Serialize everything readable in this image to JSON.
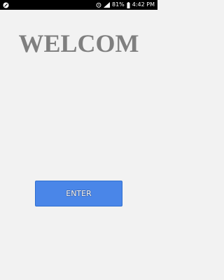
{
  "status_bar": {
    "battery_percent": "81%",
    "time": "4:42 PM",
    "icons": [
      "app-notification-icon",
      "alarm-icon",
      "signal-icon",
      "battery-icon"
    ]
  },
  "screen": {
    "title": "WELCOM",
    "enter_button_label": "ENTER"
  },
  "colors": {
    "background": "#f2f2f2",
    "title": "#7f7f7f",
    "button": "#4a86e8",
    "status_bar": "#000000"
  }
}
